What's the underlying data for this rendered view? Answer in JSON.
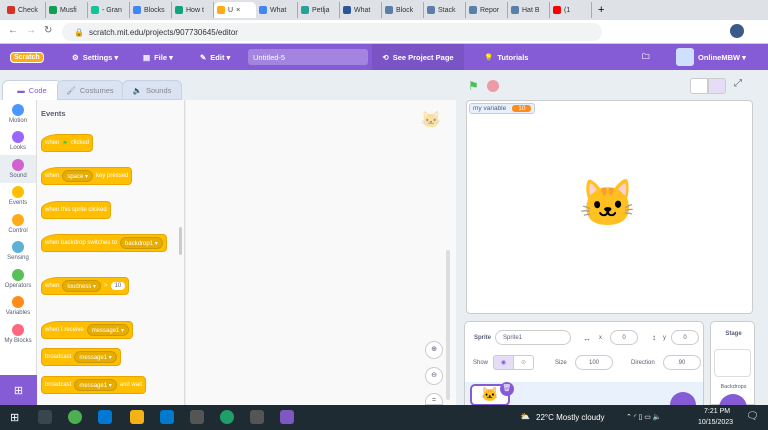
{
  "browser": {
    "tabs": [
      {
        "label": "Check",
        "color": "#d93025"
      },
      {
        "label": "Musfi",
        "color": "#0f9d58"
      },
      {
        "label": "- Gran",
        "color": "#15c39a"
      },
      {
        "label": "Blocks",
        "color": "#4285f4"
      },
      {
        "label": "How t",
        "color": "#10a37f"
      },
      {
        "label": "U",
        "color": "#ffab19",
        "active": true
      },
      {
        "label": "What",
        "color": "#4285f4"
      },
      {
        "label": "Petlja",
        "color": "#2aa198"
      },
      {
        "label": "What",
        "color": "#2b579a"
      },
      {
        "label": "Block",
        "color": "#5a7fa8"
      },
      {
        "label": "Stack",
        "color": "#5a7fa8"
      },
      {
        "label": "Repor",
        "color": "#5a7fa8"
      },
      {
        "label": "Hat B",
        "color": "#5a7fa8"
      },
      {
        "label": "(1",
        "color": "#ff0000"
      }
    ],
    "close_tab": "×",
    "new_tab": "+",
    "url": "scratch.mit.edu/projects/907730645/editor"
  },
  "menu": {
    "logo": "Scratch",
    "settings": "Settings ▾",
    "file": "File ▾",
    "edit": "Edit ▾",
    "project_title": "Untitled-5",
    "see_project": "See Project Page",
    "tutorials": "Tutorials",
    "user": "OnlineMBW ▾"
  },
  "editor_tabs": {
    "code": "Code",
    "costumes": "Costumes",
    "sounds": "Sounds"
  },
  "categories": [
    {
      "label": "Motion",
      "color": "#4c97ff"
    },
    {
      "label": "Looks",
      "color": "#9966ff"
    },
    {
      "label": "Sound",
      "color": "#cf63cf",
      "selected": true
    },
    {
      "label": "Events",
      "color": "#ffbf00"
    },
    {
      "label": "Control",
      "color": "#ffab19"
    },
    {
      "label": "Sensing",
      "color": "#5cb1d6"
    },
    {
      "label": "Operators",
      "color": "#59c059"
    },
    {
      "label": "Variables",
      "color": "#ff8c1a"
    },
    {
      "label": "My Blocks",
      "color": "#ff6680"
    }
  ],
  "palette": {
    "heading": "Events",
    "blocks": {
      "b1": {
        "a": "when",
        "b": "clicked"
      },
      "b2": {
        "a": "when",
        "dd": "space ▾",
        "b": "key pressed"
      },
      "b3": {
        "a": "when this sprite clicked"
      },
      "b4": {
        "a": "when backdrop switches to",
        "dd": "backdrop1 ▾"
      },
      "b5": {
        "a": "when",
        "dd": "loudness ▾",
        "op": ">",
        "val": "10"
      },
      "b6": {
        "a": "when I receive",
        "dd": "message1 ▾"
      },
      "b7": {
        "a": "broadcast",
        "dd": "message1 ▾"
      },
      "b8": {
        "a": "broadcast",
        "dd": "message1 ▾",
        "b": "and wait"
      }
    }
  },
  "stage": {
    "monitor_label": "my variable",
    "monitor_value": "10"
  },
  "sprite_info": {
    "sprite_label": "Sprite",
    "sprite_name": "Sprite1",
    "x_label": "x",
    "x": "0",
    "y_label": "y",
    "y": "0",
    "show_label": "Show",
    "size_label": "Size",
    "size": "100",
    "direction_label": "Direction",
    "direction": "90"
  },
  "stage_pane": {
    "title": "Stage",
    "backdrops": "Backdrops"
  },
  "taskbar": {
    "weather": "22°C  Mostly cloudy",
    "time": "7:21 PM",
    "date": "10/15/2023"
  }
}
